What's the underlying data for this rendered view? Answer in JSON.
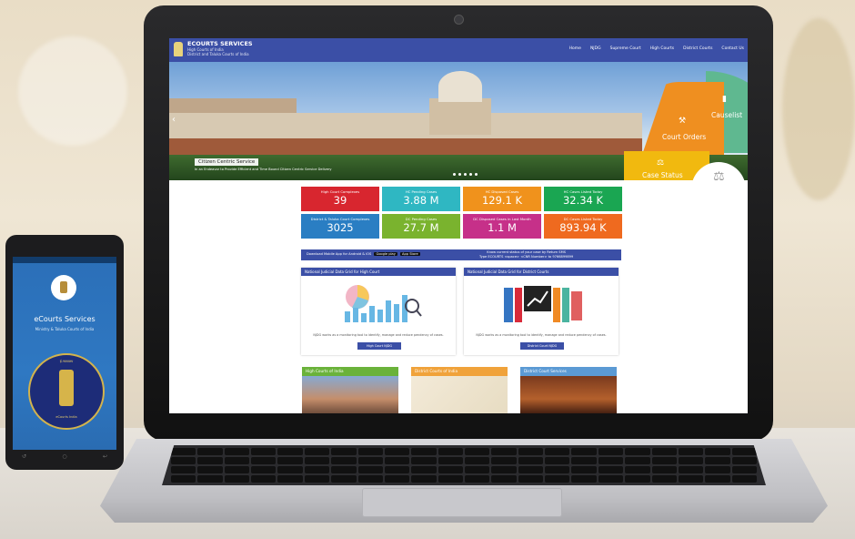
{
  "site": {
    "title": "ECOURTS SERVICES",
    "subtitle1": "High Courts of India",
    "subtitle2": "District and Taluka Courts of India",
    "nav": [
      "Home",
      "NJDG",
      "Supreme Court",
      "High Courts",
      "District Courts",
      "Contact Us"
    ]
  },
  "hero": {
    "caption": "Citizen Centric Service",
    "caption_sub": "In an Endeavor to Provide Efficient and Time Bound Citizen Centric Service Delivery",
    "wheel": [
      "Causelist",
      "Court Orders",
      "Case Status"
    ]
  },
  "stats": [
    {
      "label": "High Court Complexes",
      "value": "39",
      "color": "#d8262f"
    },
    {
      "label": "HC Pending Cases",
      "value": "3.88 M",
      "color": "#2fb7c2"
    },
    {
      "label": "HC Disposed Cases",
      "value": "129.1 K",
      "color": "#f0921c"
    },
    {
      "label": "HC Cases Listed Today",
      "value": "32.34 K",
      "color": "#1aa652"
    },
    {
      "label": "District & Taluka Court Complexes",
      "value": "3025",
      "color": "#2a7ec3"
    },
    {
      "label": "DC Pending Cases",
      "value": "27.7 M",
      "color": "#7ab32e"
    },
    {
      "label": "DC Disposed Cases in Last Month",
      "value": "1.1 M",
      "color": "#c63089"
    },
    {
      "label": "DC Cases Listed Today",
      "value": "893.94 K",
      "color": "#ef6a1f"
    }
  ],
  "banner": {
    "download": "Download Mobile App for Android & iOS",
    "google": "Google play",
    "apple": "App Store",
    "sms_title": "Know current status of your case by Return SMS",
    "sms_text": "Type ECOURTS <space> <CNR Number> to 9766899899"
  },
  "panels": [
    {
      "title": "National Judicial Data Grid for High Court",
      "desc": "NJDG works as a monitoring tool to identify, manage and reduce pendency of cases.",
      "button": "High Court NJDG"
    },
    {
      "title": "National Judicial Data Grid for District Courts",
      "desc": "NJDG works as a monitoring tool to identify, manage and reduce pendency of cases.",
      "button": "District Court NJDG"
    }
  ],
  "cards": [
    {
      "title": "High Courts of India",
      "color": "#6ab23a"
    },
    {
      "title": "District Courts of India",
      "color": "#f0a23a"
    },
    {
      "title": "District Court Services",
      "color": "#5b9ad4"
    }
  ],
  "phone": {
    "title": "eCourts Services",
    "subtitle": "Ministry & Taluka Courts of India",
    "seal_top": "ई-न्यायालय",
    "seal_bottom": "eCourts India"
  }
}
